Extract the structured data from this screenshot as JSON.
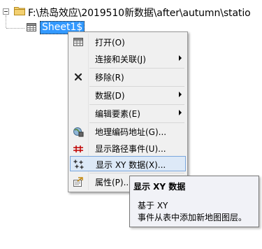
{
  "tree": {
    "folder": {
      "path": "F:\\热岛效应\\2019510新数据\\after\\autumn\\statio",
      "icon": "folder-icon",
      "expanded": true
    },
    "sheet": {
      "label": "Sheet1$",
      "icon": "table-icon",
      "selected": true
    }
  },
  "context_menu": {
    "items": [
      {
        "label": "打开(O)",
        "icon": "table-open-icon",
        "submenu": false
      },
      {
        "label": "连接和关联(J)",
        "icon": "",
        "submenu": true
      },
      {
        "label": "移除(R)",
        "icon": "remove-x-icon",
        "submenu": false
      },
      {
        "label": "数据(D)",
        "icon": "",
        "submenu": true
      },
      {
        "label": "编辑要素(E)",
        "icon": "",
        "submenu": true
      },
      {
        "label": "地理编码地址(G)...",
        "icon": "geocode-addresses-icon",
        "submenu": false
      },
      {
        "label": "显示路径事件(U)...",
        "icon": "route-events-icon",
        "submenu": false
      },
      {
        "label": "显示 XY 数据(X)...",
        "icon": "xy-data-icon",
        "submenu": false,
        "highlighted": true
      },
      {
        "label": "属性(P)...",
        "icon": "properties-icon",
        "submenu": false
      }
    ]
  },
  "tooltip": {
    "title": "显示 XY 数据",
    "line1": "基于 XY",
    "line2": "事件从表中添加新地图图层。"
  },
  "colors": {
    "selection": "#3399ff",
    "menu_background": "#f0f0f0",
    "menu_hover": "#dde9f7",
    "menu_hover_border": "#7aa7dd",
    "tooltip_background": "#f1f2f7"
  }
}
